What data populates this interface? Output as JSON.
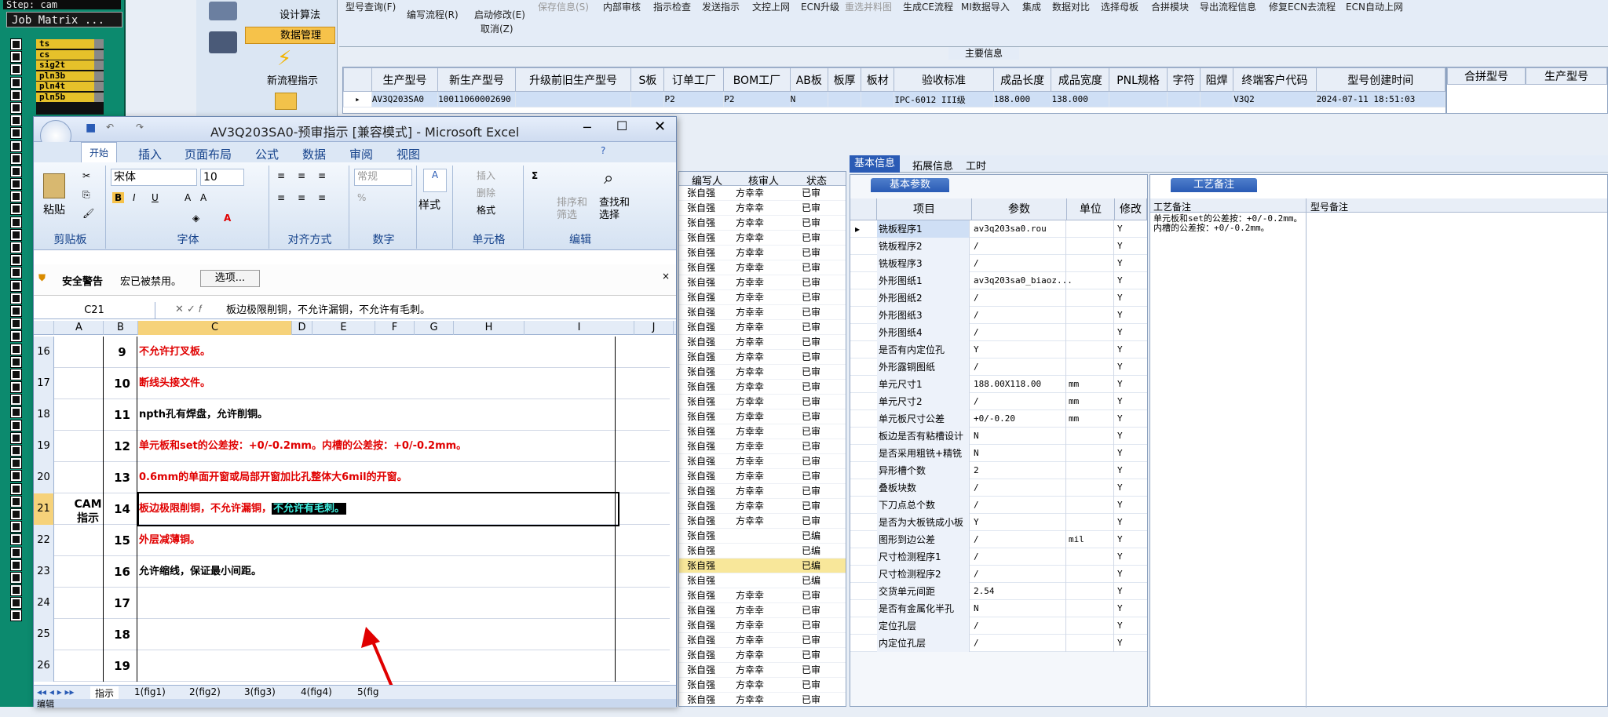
{
  "cam": {
    "step": "Step: cam",
    "job_matrix": "Job Matrix ...",
    "layers": [
      "ts",
      "cs",
      "sig2t",
      "pln3b",
      "pln4t",
      "pln5b"
    ]
  },
  "nav": {
    "items": [
      "设计算法",
      "数据管理",
      "新流程指示"
    ]
  },
  "toolbar": {
    "row1": [
      "型号查询(F)",
      "编写流程(R)",
      "启动修改(E)",
      "保存信息(S)",
      "内部审核",
      "指示检查",
      "发送指示",
      "文控上网",
      "ECN升级",
      "重选并料图",
      "生成CE流程",
      "MI数据导入",
      "集成",
      "数据对比",
      "选择母板",
      "合拼模块",
      "导出流程信息",
      "修复ECN去流程",
      "ECN自动上网"
    ],
    "row2": [
      "取消(Z)"
    ],
    "disabled": [
      "保存信息(S)",
      "重选并料图"
    ]
  },
  "main_info": {
    "title": "主要信息",
    "columns": [
      "生产型号",
      "新生产型号",
      "升级前旧生产型号",
      "S板",
      "订单工厂",
      "BOM工厂",
      "AB板",
      "板厚",
      "板材",
      "验收标准",
      "成品长度",
      "成品宽度",
      "PNL规格",
      "字符",
      "阻焊",
      "终端客户代码",
      "型号创建时间"
    ],
    "row": [
      "AV3Q203SA0",
      "10011060002690",
      "",
      "",
      "P2",
      "P2",
      "N",
      "",
      "",
      "IPC-6012 III级",
      "188.000",
      "138.000",
      "",
      "",
      "",
      "V3Q2",
      "2024-07-11 18:51:03"
    ],
    "right_columns": [
      "合拼型号",
      "生产型号"
    ]
  },
  "excel": {
    "title": "AV3Q203SA0-预审指示 [兼容模式] - Microsoft Excel",
    "tabs": [
      "开始",
      "插入",
      "页面布局",
      "公式",
      "数据",
      "审阅",
      "视图"
    ],
    "groups": {
      "clipboard": "剪贴板",
      "paste": "粘贴",
      "font": "字体",
      "font_name": "宋体",
      "font_size": "10",
      "align": "对齐方式",
      "number": "数字",
      "number_format": "常规",
      "style": "样式",
      "cells": "单元格",
      "insert": "插入",
      "delete": "删除",
      "format": "格式",
      "edit": "编辑",
      "sort": "排序和筛选",
      "find": "查找和选择"
    },
    "warning": {
      "title": "安全警告",
      "text": "宏已被禁用。",
      "button": "选项..."
    },
    "name_box": "C21",
    "formula": "板边极限削铜，不允许漏铜，不允许有毛刺。",
    "col_headers": [
      "A",
      "B",
      "C",
      "D",
      "E",
      "F",
      "G",
      "H",
      "I",
      "J"
    ],
    "cam_label": "CAM 指示",
    "rows": [
      {
        "rn": "16",
        "num": "9",
        "text": "不允许打叉板。",
        "red": true
      },
      {
        "rn": "17",
        "num": "10",
        "text": "断线头接文件。",
        "red": true
      },
      {
        "rn": "18",
        "num": "11",
        "text": "npth孔有焊盘，允许削铜。",
        "red": false
      },
      {
        "rn": "19",
        "num": "12",
        "text": "单元板和set的公差按：+0/-0.2mm。内槽的公差按：+0/-0.2mm。",
        "red": true
      },
      {
        "rn": "20",
        "num": "13",
        "text": "0.6mm的单面开窗或局部开窗加比孔整体大6mil的开窗。",
        "red": true
      },
      {
        "rn": "21",
        "num": "14",
        "text": "板边极限削铜，不允许漏铜，",
        "highlight": "不允许有毛刺。",
        "red": true
      },
      {
        "rn": "22",
        "num": "15",
        "text": "外层减薄铜。",
        "red": true
      },
      {
        "rn": "23",
        "num": "16",
        "text": "允许缩线，保证最小间距。",
        "red": false
      },
      {
        "rn": "24",
        "num": "17",
        "text": "",
        "red": false
      },
      {
        "rn": "25",
        "num": "18",
        "text": "",
        "red": false
      },
      {
        "rn": "26",
        "num": "19",
        "text": "",
        "red": false
      }
    ],
    "sheets": [
      "指示",
      "1(fig1)",
      "2(fig2)",
      "3(fig3)",
      "4(fig4)",
      "5(fig"
    ],
    "status": "编辑"
  },
  "list": {
    "headers": [
      "编写人",
      "核审人",
      "状态"
    ],
    "rows": [
      [
        "张自强",
        "方幸幸",
        "已审"
      ],
      [
        "张自强",
        "方幸幸",
        "已审"
      ],
      [
        "张自强",
        "方幸幸",
        "已审"
      ],
      [
        "张自强",
        "方幸幸",
        "已审"
      ],
      [
        "张自强",
        "方幸幸",
        "已审"
      ],
      [
        "张自强",
        "方幸幸",
        "已审"
      ],
      [
        "张自强",
        "方幸幸",
        "已审"
      ],
      [
        "张自强",
        "方幸幸",
        "已审"
      ],
      [
        "张自强",
        "方幸幸",
        "已审"
      ],
      [
        "张自强",
        "方幸幸",
        "已审"
      ],
      [
        "张自强",
        "方幸幸",
        "已审"
      ],
      [
        "张自强",
        "方幸幸",
        "已审"
      ],
      [
        "张自强",
        "方幸幸",
        "已审"
      ],
      [
        "张自强",
        "方幸幸",
        "已审"
      ],
      [
        "张自强",
        "方幸幸",
        "已审"
      ],
      [
        "张自强",
        "方幸幸",
        "已审"
      ],
      [
        "张自强",
        "方幸幸",
        "已审"
      ],
      [
        "张自强",
        "方幸幸",
        "已审"
      ],
      [
        "张自强",
        "方幸幸",
        "已审"
      ],
      [
        "张自强",
        "方幸幸",
        "已审"
      ],
      [
        "张自强",
        "方幸幸",
        "已审"
      ],
      [
        "张自强",
        "方幸幸",
        "已审"
      ],
      [
        "张自强",
        "方幸幸",
        "已审"
      ],
      [
        "张自强",
        "",
        "已编"
      ],
      [
        "张自强",
        "",
        "已编"
      ],
      [
        "张自强",
        "",
        "已编"
      ],
      [
        "张自强",
        "",
        "已编"
      ],
      [
        "张自强",
        "方幸幸",
        "已审"
      ],
      [
        "张自强",
        "方幸幸",
        "已审"
      ],
      [
        "张自强",
        "方幸幸",
        "已审"
      ],
      [
        "张自强",
        "方幸幸",
        "已审"
      ],
      [
        "张自强",
        "方幸幸",
        "已审"
      ],
      [
        "张自强",
        "方幸幸",
        "已审"
      ],
      [
        "张自强",
        "方幸幸",
        "已审"
      ],
      [
        "张自强",
        "方幸幸",
        "已审"
      ]
    ]
  },
  "right_panel": {
    "tabs": [
      "基本信息",
      "拓展信息",
      "工时"
    ],
    "basic_title": "基本参数",
    "param_headers": [
      "项目",
      "参数",
      "单位",
      "修改"
    ],
    "params": [
      [
        "铣板程序1",
        "av3q203sa0.rou",
        "",
        "Y"
      ],
      [
        "铣板程序2",
        "/",
        "",
        "Y"
      ],
      [
        "铣板程序3",
        "/",
        "",
        "Y"
      ],
      [
        "外形图纸1",
        "av3q203sa0_biaoz...",
        "",
        "Y"
      ],
      [
        "外形图纸2",
        "/",
        "",
        "Y"
      ],
      [
        "外形图纸3",
        "/",
        "",
        "Y"
      ],
      [
        "外形图纸4",
        "/",
        "",
        "Y"
      ],
      [
        "是否有内定位孔",
        "Y",
        "",
        "Y"
      ],
      [
        "外形露铜图纸",
        "/",
        "",
        "Y"
      ],
      [
        "单元尺寸1",
        "188.00X118.00",
        "mm",
        "Y"
      ],
      [
        "单元尺寸2",
        "/",
        "mm",
        "Y"
      ],
      [
        "单元板尺寸公差",
        "+0/-0.20",
        "mm",
        "Y"
      ],
      [
        "板边是否有粘槽设计",
        "N",
        "",
        "Y"
      ],
      [
        "是否采用粗铣+精铣",
        "N",
        "",
        "Y"
      ],
      [
        "异形槽个数",
        "2",
        "",
        "Y"
      ],
      [
        "叠板块数",
        "/",
        "",
        "Y"
      ],
      [
        "下刀点总个数",
        "/",
        "",
        "Y"
      ],
      [
        "是否为大板铣成小板",
        "Y",
        "",
        "Y"
      ],
      [
        "图形到边公差",
        "/",
        "mil",
        "Y"
      ],
      [
        "尺寸检测程序1",
        "/",
        "",
        "Y"
      ],
      [
        "尺寸检测程序2",
        "/",
        "",
        "Y"
      ],
      [
        "交货单元间距",
        "2.54",
        "",
        "Y"
      ],
      [
        "是否有金属化半孔",
        "N",
        "",
        "Y"
      ],
      [
        "定位孔层",
        "/",
        "",
        "Y"
      ],
      [
        "内定位孔层",
        "/",
        "",
        "Y"
      ]
    ],
    "proc_title": "工艺备注",
    "proc_headers": [
      "工艺备注",
      "型号备注"
    ],
    "proc_note": "单元板和set的公差按：+0/-0.2mm。内槽的公差按：+0/-0.2mm。"
  }
}
